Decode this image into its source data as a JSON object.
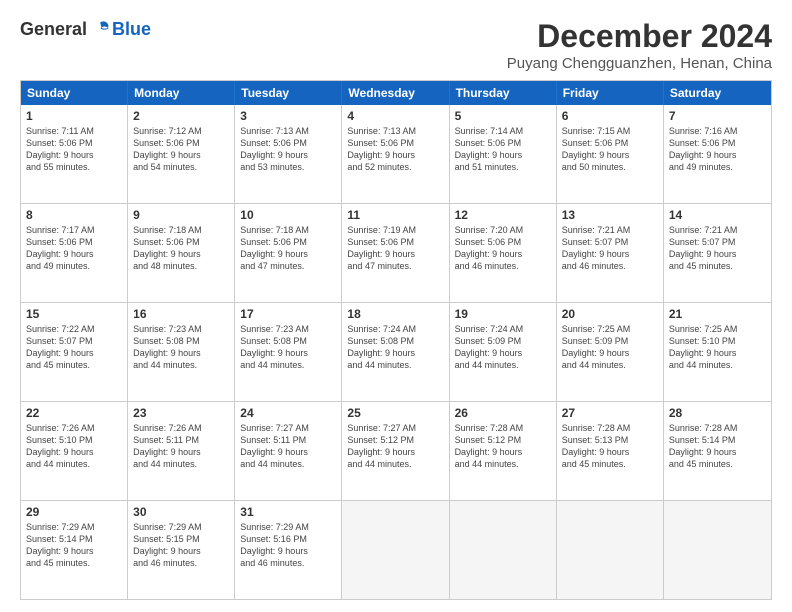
{
  "header": {
    "logo_general": "General",
    "logo_blue": "Blue",
    "month_title": "December 2024",
    "location": "Puyang Chengguanzhen, Henan, China"
  },
  "weekdays": [
    "Sunday",
    "Monday",
    "Tuesday",
    "Wednesday",
    "Thursday",
    "Friday",
    "Saturday"
  ],
  "weeks": [
    [
      {
        "day": "1",
        "text": "Sunrise: 7:11 AM\nSunset: 5:06 PM\nDaylight: 9 hours\nand 55 minutes."
      },
      {
        "day": "2",
        "text": "Sunrise: 7:12 AM\nSunset: 5:06 PM\nDaylight: 9 hours\nand 54 minutes."
      },
      {
        "day": "3",
        "text": "Sunrise: 7:13 AM\nSunset: 5:06 PM\nDaylight: 9 hours\nand 53 minutes."
      },
      {
        "day": "4",
        "text": "Sunrise: 7:13 AM\nSunset: 5:06 PM\nDaylight: 9 hours\nand 52 minutes."
      },
      {
        "day": "5",
        "text": "Sunrise: 7:14 AM\nSunset: 5:06 PM\nDaylight: 9 hours\nand 51 minutes."
      },
      {
        "day": "6",
        "text": "Sunrise: 7:15 AM\nSunset: 5:06 PM\nDaylight: 9 hours\nand 50 minutes."
      },
      {
        "day": "7",
        "text": "Sunrise: 7:16 AM\nSunset: 5:06 PM\nDaylight: 9 hours\nand 49 minutes."
      }
    ],
    [
      {
        "day": "8",
        "text": "Sunrise: 7:17 AM\nSunset: 5:06 PM\nDaylight: 9 hours\nand 49 minutes."
      },
      {
        "day": "9",
        "text": "Sunrise: 7:18 AM\nSunset: 5:06 PM\nDaylight: 9 hours\nand 48 minutes."
      },
      {
        "day": "10",
        "text": "Sunrise: 7:18 AM\nSunset: 5:06 PM\nDaylight: 9 hours\nand 47 minutes."
      },
      {
        "day": "11",
        "text": "Sunrise: 7:19 AM\nSunset: 5:06 PM\nDaylight: 9 hours\nand 47 minutes."
      },
      {
        "day": "12",
        "text": "Sunrise: 7:20 AM\nSunset: 5:06 PM\nDaylight: 9 hours\nand 46 minutes."
      },
      {
        "day": "13",
        "text": "Sunrise: 7:21 AM\nSunset: 5:07 PM\nDaylight: 9 hours\nand 46 minutes."
      },
      {
        "day": "14",
        "text": "Sunrise: 7:21 AM\nSunset: 5:07 PM\nDaylight: 9 hours\nand 45 minutes."
      }
    ],
    [
      {
        "day": "15",
        "text": "Sunrise: 7:22 AM\nSunset: 5:07 PM\nDaylight: 9 hours\nand 45 minutes."
      },
      {
        "day": "16",
        "text": "Sunrise: 7:23 AM\nSunset: 5:08 PM\nDaylight: 9 hours\nand 44 minutes."
      },
      {
        "day": "17",
        "text": "Sunrise: 7:23 AM\nSunset: 5:08 PM\nDaylight: 9 hours\nand 44 minutes."
      },
      {
        "day": "18",
        "text": "Sunrise: 7:24 AM\nSunset: 5:08 PM\nDaylight: 9 hours\nand 44 minutes."
      },
      {
        "day": "19",
        "text": "Sunrise: 7:24 AM\nSunset: 5:09 PM\nDaylight: 9 hours\nand 44 minutes."
      },
      {
        "day": "20",
        "text": "Sunrise: 7:25 AM\nSunset: 5:09 PM\nDaylight: 9 hours\nand 44 minutes."
      },
      {
        "day": "21",
        "text": "Sunrise: 7:25 AM\nSunset: 5:10 PM\nDaylight: 9 hours\nand 44 minutes."
      }
    ],
    [
      {
        "day": "22",
        "text": "Sunrise: 7:26 AM\nSunset: 5:10 PM\nDaylight: 9 hours\nand 44 minutes."
      },
      {
        "day": "23",
        "text": "Sunrise: 7:26 AM\nSunset: 5:11 PM\nDaylight: 9 hours\nand 44 minutes."
      },
      {
        "day": "24",
        "text": "Sunrise: 7:27 AM\nSunset: 5:11 PM\nDaylight: 9 hours\nand 44 minutes."
      },
      {
        "day": "25",
        "text": "Sunrise: 7:27 AM\nSunset: 5:12 PM\nDaylight: 9 hours\nand 44 minutes."
      },
      {
        "day": "26",
        "text": "Sunrise: 7:28 AM\nSunset: 5:12 PM\nDaylight: 9 hours\nand 44 minutes."
      },
      {
        "day": "27",
        "text": "Sunrise: 7:28 AM\nSunset: 5:13 PM\nDaylight: 9 hours\nand 45 minutes."
      },
      {
        "day": "28",
        "text": "Sunrise: 7:28 AM\nSunset: 5:14 PM\nDaylight: 9 hours\nand 45 minutes."
      }
    ],
    [
      {
        "day": "29",
        "text": "Sunrise: 7:29 AM\nSunset: 5:14 PM\nDaylight: 9 hours\nand 45 minutes."
      },
      {
        "day": "30",
        "text": "Sunrise: 7:29 AM\nSunset: 5:15 PM\nDaylight: 9 hours\nand 46 minutes."
      },
      {
        "day": "31",
        "text": "Sunrise: 7:29 AM\nSunset: 5:16 PM\nDaylight: 9 hours\nand 46 minutes."
      },
      null,
      null,
      null,
      null
    ]
  ]
}
